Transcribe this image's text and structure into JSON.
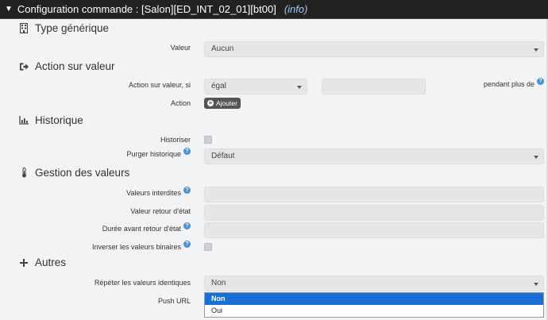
{
  "title": {
    "text": "Configuration commande : [Salon][ED_INT_02_01][bt00]",
    "info": "(info)"
  },
  "sections": {
    "type_generique": "Type générique",
    "action_sur_valeur": "Action sur valeur",
    "historique": "Historique",
    "gestion_valeurs": "Gestion des valeurs",
    "autres": "Autres"
  },
  "labels": {
    "valeur": "Valeur",
    "action_sur_valeur_si": "Action sur valeur, si",
    "pendant_plus_de": "pendant plus de",
    "action": "Action",
    "historiser": "Historiser",
    "purger_historique": "Purger historique",
    "valeurs_interdites": "Valeurs interdites",
    "valeur_retour_etat": "Valeur retour d'état",
    "duree_avant_retour": "Durée avant retour d'état",
    "inverser_binaires": "Inverser les valeurs binaires",
    "repeter_identiques": "Répéter les valeurs identiques",
    "push_url": "Push URL"
  },
  "fields": {
    "valeur_value": "Aucun",
    "condition_value": "égal",
    "condition_value_input": "",
    "purger_value": "Défaut",
    "valeurs_interdites_value": "",
    "valeur_retour_value": "",
    "duree_retour_value": "",
    "repeter_value": "Non"
  },
  "buttons": {
    "ajouter": "Ajouter"
  },
  "dropdown": {
    "options": [
      "Non",
      "Oui"
    ],
    "selected": "Non"
  },
  "icons": {
    "type_generique": "building-icon",
    "action_sur_valeur": "sign-out-icon",
    "historique": "bar-chart-icon",
    "gestion_valeurs": "thermometer-icon",
    "autres": "plus-icon",
    "help": "question-icon"
  },
  "colors": {
    "titlebar_bg": "#222222",
    "info": "#9cc9ff",
    "selected_option": "#1a6fd6",
    "help": "#4a90d9"
  }
}
